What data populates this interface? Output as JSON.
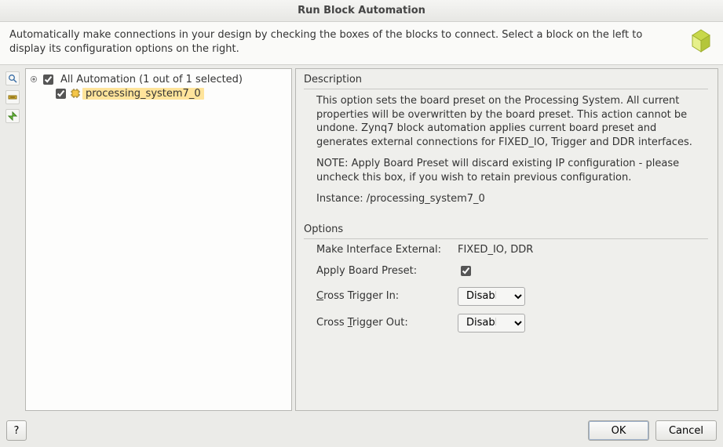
{
  "window": {
    "title": "Run Block Automation"
  },
  "infobar": {
    "text": "Automatically make connections in your design by checking the boxes of the blocks to connect. Select a block on the left to display its configuration options on the right."
  },
  "tree": {
    "root_label": "All Automation (1 out of 1 selected)",
    "root_checked": true,
    "items": [
      {
        "label": "processing_system7_0",
        "checked": true,
        "selected": true
      }
    ]
  },
  "description": {
    "title": "Description",
    "paragraph1": "This option sets the board preset on the Processing System. All current properties will be overwritten by the board preset. This action cannot be undone. Zynq7 block automation applies current board preset and generates external connections for FIXED_IO, Trigger and DDR interfaces.",
    "paragraph2": "NOTE: Apply Board Preset will discard existing IP configuration - please uncheck this box, if you wish to retain previous configuration.",
    "instance_label": "Instance: /processing_system7_0"
  },
  "options": {
    "title": "Options",
    "make_interface_external_label": "Make Interface External:",
    "make_interface_external_value": "FIXED_IO, DDR",
    "apply_board_preset_label": "Apply Board Preset:",
    "apply_board_preset_checked": true,
    "cross_trigger_in_label_pre": "",
    "cross_trigger_in_underline": "C",
    "cross_trigger_in_label_post": "ross Trigger In:",
    "cross_trigger_in_value": "Disable",
    "cross_trigger_out_label_pre": "Cross ",
    "cross_trigger_out_underline": "T",
    "cross_trigger_out_label_post": "rigger Out:",
    "cross_trigger_out_value": "Disable"
  },
  "footer": {
    "help": "?",
    "ok": "OK",
    "cancel": "Cancel"
  }
}
